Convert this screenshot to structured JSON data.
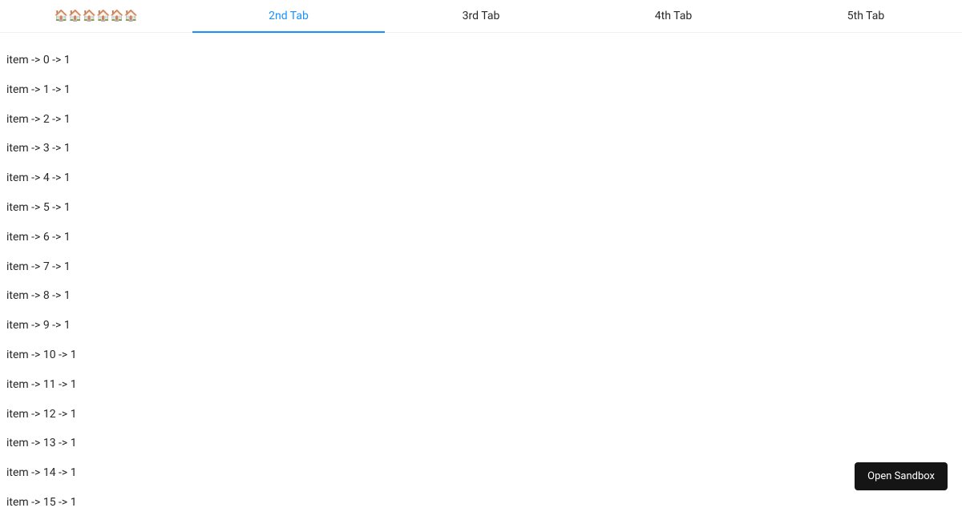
{
  "tabs": [
    {
      "label": "🏠🏠🏠🏠🏠🏠",
      "active": false
    },
    {
      "label": "2nd Tab",
      "active": true
    },
    {
      "label": "3rd Tab",
      "active": false
    },
    {
      "label": "4th Tab",
      "active": false
    },
    {
      "label": "5th Tab",
      "active": false
    }
  ],
  "items": [
    "item -> 0 -> 1",
    "item -> 1 -> 1",
    "item -> 2 -> 1",
    "item -> 3 -> 1",
    "item -> 4 -> 1",
    "item -> 5 -> 1",
    "item -> 6 -> 1",
    "item -> 7 -> 1",
    "item -> 8 -> 1",
    "item -> 9 -> 1",
    "item -> 10 -> 1",
    "item -> 11 -> 1",
    "item -> 12 -> 1",
    "item -> 13 -> 1",
    "item -> 14 -> 1",
    "item -> 15 -> 1"
  ],
  "sandbox": {
    "label": "Open Sandbox"
  }
}
